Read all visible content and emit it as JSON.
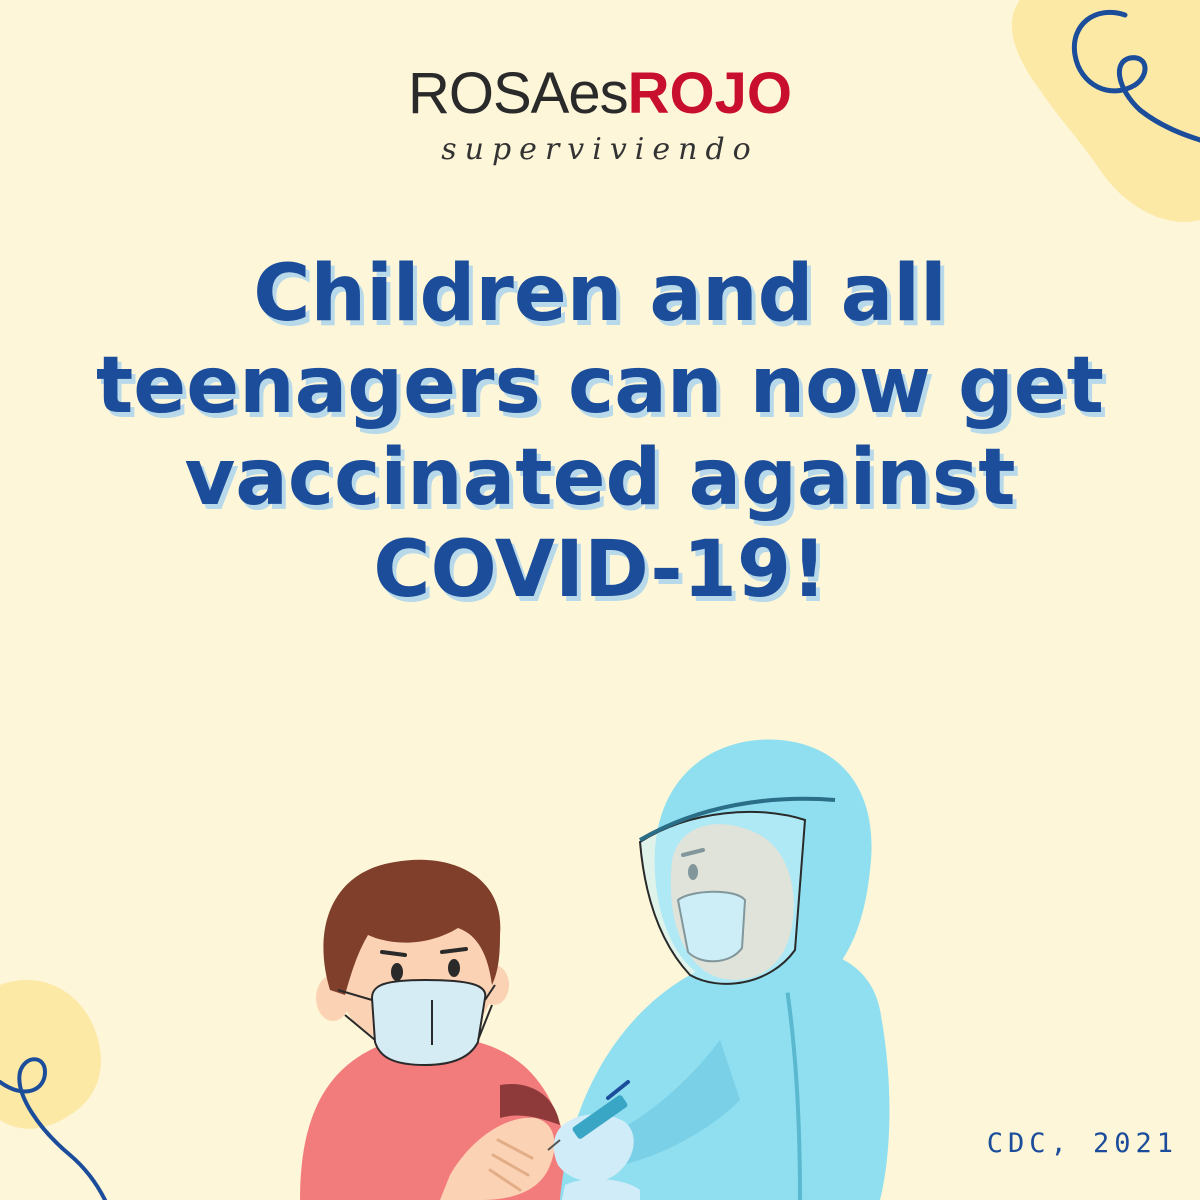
{
  "brand": {
    "name_part1": "ROSAes",
    "name_part2": "ROJO",
    "tagline": "superviviendo"
  },
  "headline": {
    "lines": [
      "Children and all",
      "teenagers can now get",
      "vaccinated against",
      "COVID-19!"
    ]
  },
  "citation": "CDC, 2021",
  "colors": {
    "background": "#fdf6d9",
    "headline": "#1b4d9b",
    "headline_shadow": "#b8d9ea",
    "brand_red": "#c8102e",
    "blob": "#fde9a6"
  }
}
